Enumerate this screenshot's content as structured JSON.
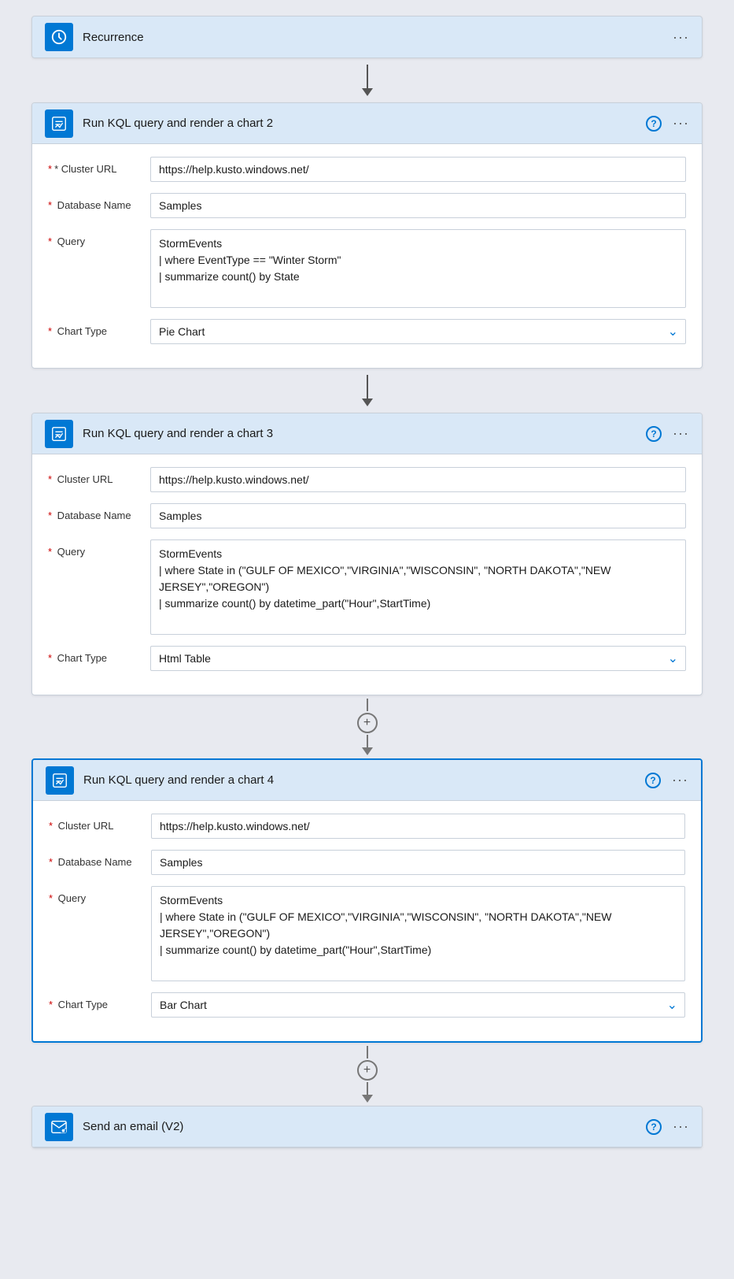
{
  "recurrence": {
    "title": "Recurrence",
    "icon": "recurrence"
  },
  "card2": {
    "title": "Run KQL query and render a chart 2",
    "clusterUrl": "https://help.kusto.windows.net/",
    "databaseName": "Samples",
    "query": "StormEvents\n| where EventType == \"Winter Storm\"\n| summarize count() by State",
    "chartType": "Pie Chart",
    "labels": {
      "clusterUrl": "* Cluster URL",
      "databaseName": "* Database Name",
      "query": "* Query",
      "chartType": "* Chart Type"
    }
  },
  "card3": {
    "title": "Run KQL query and render a chart 3",
    "clusterUrl": "https://help.kusto.windows.net/",
    "databaseName": "Samples",
    "query": "StormEvents\n| where State in (\"GULF OF MEXICO\",\"VIRGINIA\",\"WISCONSIN\", \"NORTH DAKOTA\",\"NEW JERSEY\",\"OREGON\")\n| summarize count() by datetime_part(\"Hour\",StartTime)",
    "chartType": "Html Table",
    "labels": {
      "clusterUrl": "* Cluster URL",
      "databaseName": "* Database Name",
      "query": "* Query",
      "chartType": "* Chart Type"
    }
  },
  "card4": {
    "title": "Run KQL query and render a chart 4",
    "clusterUrl": "https://help.kusto.windows.net/",
    "databaseName": "Samples",
    "query": "StormEvents\n| where State in (\"GULF OF MEXICO\",\"VIRGINIA\",\"WISCONSIN\", \"NORTH DAKOTA\",\"NEW JERSEY\",\"OREGON\")\n| summarize count() by datetime_part(\"Hour\",StartTime)",
    "chartType": "Bar Chart",
    "labels": {
      "clusterUrl": "* Cluster URL",
      "databaseName": "* Database Name",
      "query": "* Query",
      "chartType": "* Chart Type"
    }
  },
  "sendEmail": {
    "title": "Send an email (V2)",
    "icon": "email"
  },
  "ui": {
    "helpLabel": "?",
    "ellipsis": "···",
    "plusLabel": "+"
  }
}
